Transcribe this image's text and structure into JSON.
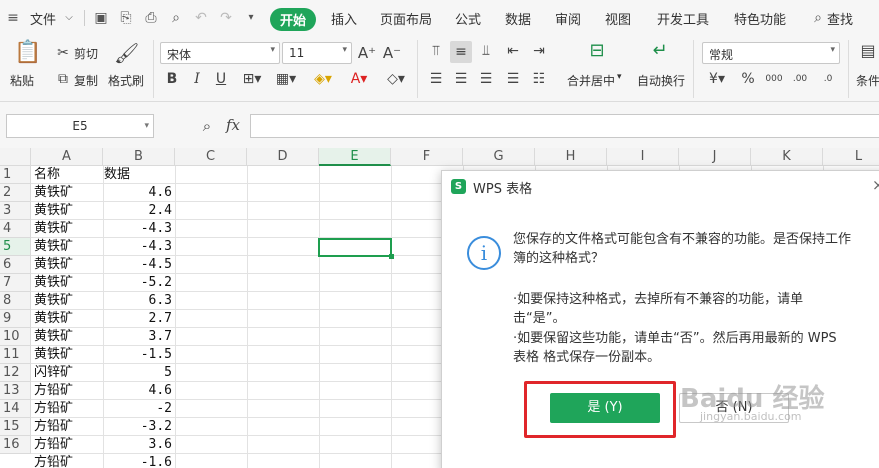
{
  "menubar": {
    "file_label": "文件",
    "tabs": [
      "开始",
      "插入",
      "页面布局",
      "公式",
      "数据",
      "审阅",
      "视图",
      "开发工具",
      "特色功能"
    ],
    "search_label": "查找"
  },
  "ribbon": {
    "paste": "粘贴",
    "cut": "剪切",
    "copy": "复制",
    "format_painter": "格式刷",
    "font_name": "宋体",
    "font_size": "11",
    "merge_center": "合并居中",
    "wrap_text": "自动换行",
    "number_format": "常规",
    "conditional": "条件"
  },
  "formula_bar": {
    "cell_ref": "E5",
    "fx_label": "fx"
  },
  "grid": {
    "columns": [
      "A",
      "B",
      "C",
      "D",
      "E",
      "F",
      "G",
      "H",
      "I",
      "J",
      "K",
      "L"
    ],
    "selected_column": "E",
    "rows": [
      "1",
      "2",
      "3",
      "4",
      "5",
      "6",
      "7",
      "8",
      "9",
      "10",
      "11",
      "12",
      "13",
      "14",
      "15",
      "16"
    ],
    "selected_row": "5",
    "data": [
      [
        "名称",
        "数据"
      ],
      [
        "黄铁矿",
        "4.6"
      ],
      [
        "黄铁矿",
        "2.4"
      ],
      [
        "黄铁矿",
        "-4.3"
      ],
      [
        "黄铁矿",
        "-4.3"
      ],
      [
        "黄铁矿",
        "-4.5"
      ],
      [
        "黄铁矿",
        "-5.2"
      ],
      [
        "黄铁矿",
        "6.3"
      ],
      [
        "黄铁矿",
        "2.7"
      ],
      [
        "黄铁矿",
        "3.7"
      ],
      [
        "黄铁矿",
        "-1.5"
      ],
      [
        "闪锌矿",
        "5"
      ],
      [
        "方铅矿",
        "4.6"
      ],
      [
        "方铅矿",
        "-2"
      ],
      [
        "方铅矿",
        "-3.2"
      ],
      [
        "方铅矿",
        "3.6"
      ],
      [
        "方铅矿",
        "-1.6"
      ]
    ]
  },
  "dialog": {
    "title": "WPS 表格",
    "close": "×",
    "info_glyph": "i",
    "line1": "您保存的文件格式可能包含有不兼容的功能。是否保持工作",
    "line2": "簿的这种格式？",
    "line3": "·如要保持这种格式，去掉所有不兼容的功能，请单",
    "line4": "击“是”。",
    "line5": "·如要保留这些功能，请单击“否”。然后再用最新的 WPS",
    "line6": "表格 格式保存一份副本。",
    "yes_button": "是 (Y)",
    "no_button": "否 (N)"
  },
  "watermark": {
    "text": "Baidu 经验",
    "url": "jingyan.baidu.com"
  },
  "colors": {
    "accent": "#1fa55a",
    "highlight": "#e0262a",
    "info": "#3a8ddc"
  }
}
